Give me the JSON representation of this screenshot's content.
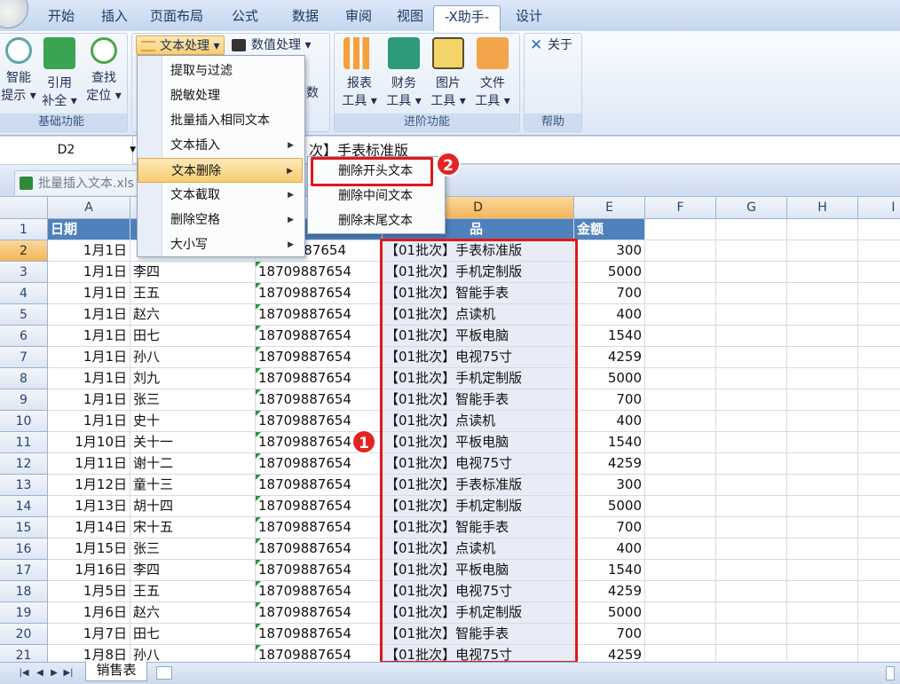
{
  "ribbon_tabs": [
    "开始",
    "插入",
    "页面布局",
    "公式",
    "数据",
    "审阅",
    "视图",
    "-X助手-",
    "设计"
  ],
  "ribbon": {
    "group_basic": {
      "label": "基础功能",
      "btn_smart": [
        "智能",
        "提示 ▾"
      ],
      "btn_ref": [
        "引用",
        "补全 ▾"
      ],
      "btn_find": [
        "查找",
        "定位 ▾"
      ]
    },
    "text_processing": "文本处理 ▾",
    "numeric_processing": "数值处理 ▾",
    "partial_label": "数",
    "group_advanced": {
      "label": "进阶功能",
      "btn_report": [
        "报表",
        "工具 ▾"
      ],
      "btn_finance": [
        "财务",
        "工具 ▾"
      ],
      "btn_image": [
        "图片",
        "工具 ▾"
      ],
      "btn_file": [
        "文件",
        "工具 ▾"
      ]
    },
    "group_help": {
      "label": "帮助",
      "about": "关于"
    }
  },
  "name_box": "D2",
  "formula_visible": "次】手表标准版",
  "workbook_tab": "批量插入文本.xls",
  "menu": {
    "items": [
      {
        "label": "提取与过滤",
        "submenu": false
      },
      {
        "label": "脱敏处理",
        "submenu": false
      },
      {
        "label": "批量插入相同文本",
        "submenu": false
      },
      {
        "label": "文本插入",
        "submenu": true
      },
      {
        "label": "文本删除",
        "submenu": true,
        "highlighted": true
      },
      {
        "label": "文本截取",
        "submenu": true
      },
      {
        "label": "删除空格",
        "submenu": true
      },
      {
        "label": "大小写",
        "submenu": true
      }
    ],
    "arrow_glyph": "▶",
    "submenu": [
      "删除开头文本",
      "删除中间文本",
      "删除末尾文本"
    ]
  },
  "badges": [
    "1",
    "2"
  ],
  "columns": [
    "A",
    "D",
    "E",
    "F",
    "G",
    "H",
    "I"
  ],
  "header_row": {
    "A": "日期",
    "D_partial": "品",
    "E": "金额"
  },
  "rows": [
    {
      "n": "1"
    },
    {
      "n": "2",
      "date": "1月1日",
      "name": "",
      "phone": "87654",
      "product": "【01批次】手表标准版",
      "amount": "300"
    },
    {
      "n": "3",
      "date": "1月1日",
      "name": "李四",
      "phone": "18709887654",
      "product": "【01批次】手机定制版",
      "amount": "5000"
    },
    {
      "n": "4",
      "date": "1月1日",
      "name": "王五",
      "phone": "18709887654",
      "product": "【01批次】智能手表",
      "amount": "700"
    },
    {
      "n": "5",
      "date": "1月1日",
      "name": "赵六",
      "phone": "18709887654",
      "product": "【01批次】点读机",
      "amount": "400"
    },
    {
      "n": "6",
      "date": "1月1日",
      "name": "田七",
      "phone": "18709887654",
      "product": "【01批次】平板电脑",
      "amount": "1540"
    },
    {
      "n": "7",
      "date": "1月1日",
      "name": "孙八",
      "phone": "18709887654",
      "product": "【01批次】电视75寸",
      "amount": "4259"
    },
    {
      "n": "8",
      "date": "1月1日",
      "name": "刘九",
      "phone": "18709887654",
      "product": "【01批次】手机定制版",
      "amount": "5000"
    },
    {
      "n": "9",
      "date": "1月1日",
      "name": "张三",
      "phone": "18709887654",
      "product": "【01批次】智能手表",
      "amount": "700"
    },
    {
      "n": "10",
      "date": "1月1日",
      "name": "史十",
      "phone": "18709887654",
      "product": "【01批次】点读机",
      "amount": "400"
    },
    {
      "n": "11",
      "date": "1月10日",
      "name": "关十一",
      "phone": "18709887654",
      "product": "【01批次】平板电脑",
      "amount": "1540"
    },
    {
      "n": "12",
      "date": "1月11日",
      "name": "谢十二",
      "phone": "18709887654",
      "product": "【01批次】电视75寸",
      "amount": "4259"
    },
    {
      "n": "13",
      "date": "1月12日",
      "name": "童十三",
      "phone": "18709887654",
      "product": "【01批次】手表标准版",
      "amount": "300"
    },
    {
      "n": "14",
      "date": "1月13日",
      "name": "胡十四",
      "phone": "18709887654",
      "product": "【01批次】手机定制版",
      "amount": "5000"
    },
    {
      "n": "15",
      "date": "1月14日",
      "name": "宋十五",
      "phone": "18709887654",
      "product": "【01批次】智能手表",
      "amount": "700"
    },
    {
      "n": "16",
      "date": "1月15日",
      "name": "张三",
      "phone": "18709887654",
      "product": "【01批次】点读机",
      "amount": "400"
    },
    {
      "n": "17",
      "date": "1月16日",
      "name": "李四",
      "phone": "18709887654",
      "product": "【01批次】平板电脑",
      "amount": "1540"
    },
    {
      "n": "18",
      "date": "1月5日",
      "name": "王五",
      "phone": "18709887654",
      "product": "【01批次】电视75寸",
      "amount": "4259"
    },
    {
      "n": "19",
      "date": "1月6日",
      "name": "赵六",
      "phone": "18709887654",
      "product": "【01批次】手机定制版",
      "amount": "5000"
    },
    {
      "n": "20",
      "date": "1月7日",
      "name": "田七",
      "phone": "18709887654",
      "product": "【01批次】智能手表",
      "amount": "700"
    },
    {
      "n": "21",
      "date": "1月8日",
      "name": "孙八",
      "phone": "18709887654",
      "product": "【01批次】电视75寸",
      "amount": "4259"
    }
  ],
  "sheet_tab": "销售表",
  "colors": {
    "accent": "#4f81bd",
    "highlight_red": "#e01818",
    "selected_header": "#f3b65a"
  }
}
